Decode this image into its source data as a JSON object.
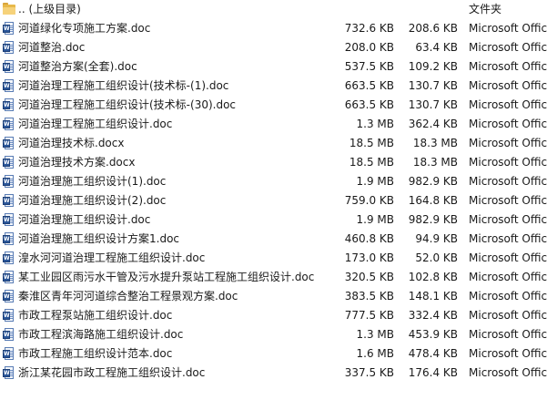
{
  "parent_row": {
    "name": ".. (上级目录)",
    "type": "文件夹"
  },
  "files": [
    {
      "name": "河道绿化专项施工方案.doc",
      "size": "732.6 KB",
      "packed": "208.6 KB",
      "type": "Microsoft Office"
    },
    {
      "name": "河道整治.doc",
      "size": "208.0 KB",
      "packed": "63.4 KB",
      "type": "Microsoft Office"
    },
    {
      "name": "河道整治方案(全套).doc",
      "size": "537.5 KB",
      "packed": "109.2 KB",
      "type": "Microsoft Office"
    },
    {
      "name": "河道治理工程施工组织设计(技术标-(1).doc",
      "size": "663.5 KB",
      "packed": "130.7 KB",
      "type": "Microsoft Office"
    },
    {
      "name": "河道治理工程施工组织设计(技术标-(30).doc",
      "size": "663.5 KB",
      "packed": "130.7 KB",
      "type": "Microsoft Office"
    },
    {
      "name": "河道治理工程施工组织设计.doc",
      "size": "1.3 MB",
      "packed": "362.4 KB",
      "type": "Microsoft Office"
    },
    {
      "name": "河道治理技术标.docx",
      "size": "18.5 MB",
      "packed": "18.3 MB",
      "type": "Microsoft Office"
    },
    {
      "name": "河道治理技术方案.docx",
      "size": "18.5 MB",
      "packed": "18.3 MB",
      "type": "Microsoft Office"
    },
    {
      "name": "河道治理施工组织设计(1).doc",
      "size": "1.9 MB",
      "packed": "982.9 KB",
      "type": "Microsoft Office"
    },
    {
      "name": "河道治理施工组织设计(2).doc",
      "size": "759.0 KB",
      "packed": "164.8 KB",
      "type": "Microsoft Office"
    },
    {
      "name": "河道治理施工组织设计.doc",
      "size": "1.9 MB",
      "packed": "982.9 KB",
      "type": "Microsoft Office"
    },
    {
      "name": "河道治理施工组织设计方案1.doc",
      "size": "460.8 KB",
      "packed": "94.9 KB",
      "type": "Microsoft Office"
    },
    {
      "name": "湟水河河道治理工程施工组织设计.doc",
      "size": "173.0 KB",
      "packed": "52.0 KB",
      "type": "Microsoft Office"
    },
    {
      "name": "某工业园区雨污水干管及污水提升泵站工程施工组织设计.doc",
      "size": "320.5 KB",
      "packed": "102.8 KB",
      "type": "Microsoft Office"
    },
    {
      "name": "秦淮区青年河河道综合整治工程景观方案.doc",
      "size": "383.5 KB",
      "packed": "148.1 KB",
      "type": "Microsoft Office"
    },
    {
      "name": "市政工程泵站施工组织设计.doc",
      "size": "777.5 KB",
      "packed": "332.4 KB",
      "type": "Microsoft Office"
    },
    {
      "name": "市政工程滨海路施工组织设计.doc",
      "size": "1.3 MB",
      "packed": "453.9 KB",
      "type": "Microsoft Office"
    },
    {
      "name": "市政工程施工组织设计范本.doc",
      "size": "1.6 MB",
      "packed": "478.4 KB",
      "type": "Microsoft Office"
    },
    {
      "name": "浙江某花园市政工程施工组织设计.doc",
      "size": "337.5 KB",
      "packed": "176.4 KB",
      "type": "Microsoft Office"
    }
  ],
  "icons": {
    "parent": "folder-icon",
    "file": "word-document-icon"
  },
  "colors": {
    "word_blue": "#2b579a",
    "folder_yellow": "#e8b94a"
  }
}
